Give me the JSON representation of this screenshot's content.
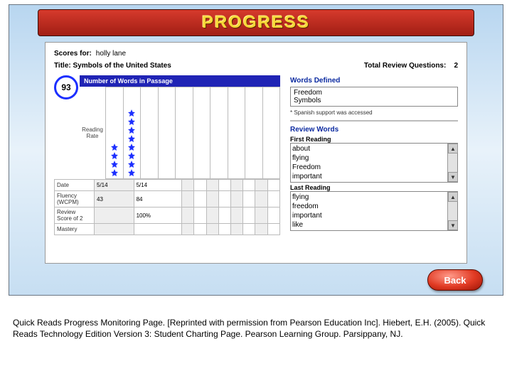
{
  "banner": {
    "title": "PROGRESS"
  },
  "meta": {
    "scores_for_label": "Scores for:",
    "student_name": "holly lane",
    "title_label": "Title:",
    "title_value": "Symbols of the United States",
    "total_review_label": "Total Review Questions:",
    "total_review_value": "2"
  },
  "chart": {
    "badge_value": "93",
    "header": "Number of Words in Passage",
    "ylabel": "Reading Rate",
    "rows": [
      {
        "label": "Date",
        "values": [
          "5/14",
          "5/14",
          "",
          "",
          "",
          "",
          "",
          "",
          "",
          ""
        ]
      },
      {
        "label": "Fluency (WCPM)",
        "values": [
          "43",
          "84",
          "",
          "",
          "",
          "",
          "",
          "",
          "",
          ""
        ]
      },
      {
        "label": "Review Score of 2",
        "values": [
          "",
          "100%",
          "",
          "",
          "",
          "",
          "",
          "",
          "",
          ""
        ]
      },
      {
        "label": "Mastery",
        "values": [
          "",
          "",
          "",
          "",
          "",
          "",
          "",
          "",
          "",
          ""
        ]
      }
    ]
  },
  "chart_data": {
    "type": "bar",
    "title": "Number of Words in Passage",
    "ylabel": "Reading Rate",
    "categories": [
      "5/14",
      "5/14"
    ],
    "series": [
      {
        "name": "Fluency (WCPM)",
        "values": [
          43,
          84
        ]
      },
      {
        "name": "Review Score of 2 (%)",
        "values": [
          null,
          100
        ]
      }
    ],
    "star_counts": [
      4,
      8
    ],
    "ylim": [
      0,
      93
    ]
  },
  "right": {
    "words_defined_label": "Words Defined",
    "words_defined": [
      "Freedom",
      "Symbols"
    ],
    "spanish_note": "* Spanish support was accessed",
    "review_words_label": "Review Words",
    "first_reading_label": "First Reading",
    "first_reading": [
      "about",
      "flying",
      "Freedom",
      "important"
    ],
    "last_reading_label": "Last Reading",
    "last_reading": [
      "flying",
      "freedom",
      "important",
      "like"
    ]
  },
  "back_label": "Back",
  "caption": "Quick Reads Progress Monitoring Page. [Reprinted with permission from Pearson Education Inc]. Hiebert, E.H. (2005). Quick Reads Technology Edition Version 3: Student Charting Page. Pearson Learning Group. Parsippany, NJ."
}
